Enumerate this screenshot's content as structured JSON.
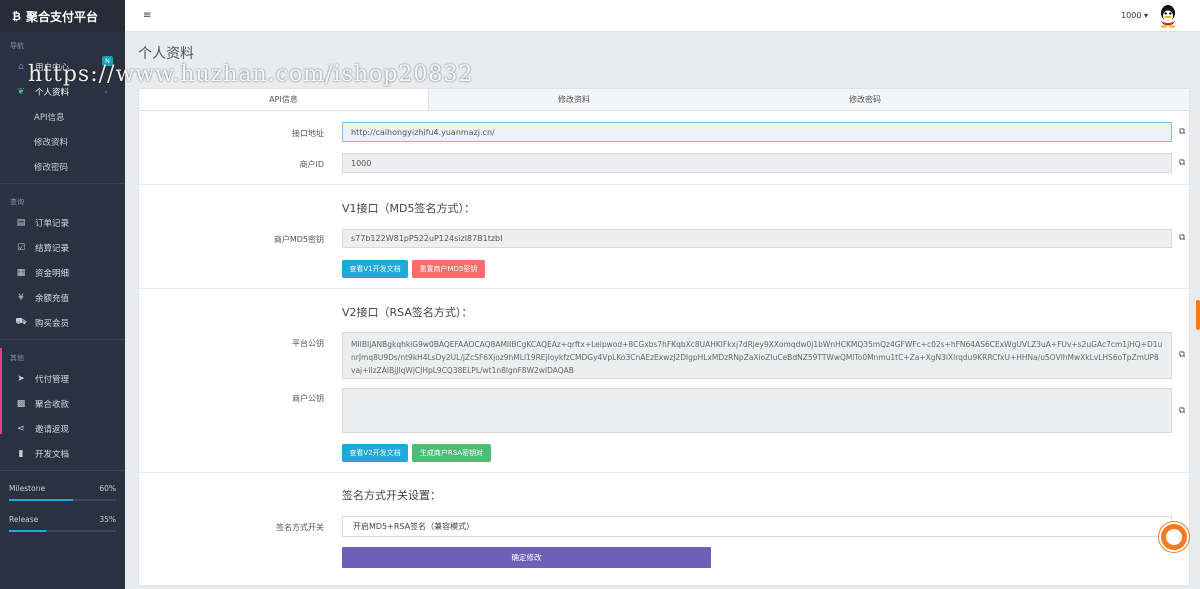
{
  "brand": {
    "logo": "₿",
    "title": "聚合支付平台"
  },
  "sidebar": {
    "section_nav": "导航",
    "user_center": "用户中心",
    "user_center_badge": "N",
    "profile": "个人资料",
    "api_info": "API信息",
    "edit_profile": "修改资料",
    "change_password": "修改密码",
    "section_query": "查询",
    "orders": "订单记录",
    "settlements": "结算记录",
    "funds": "资金明细",
    "recharge": "余额充值",
    "buy_member": "购买会员",
    "section_other": "其他",
    "payout": "代付管理",
    "aggregate_collect": "聚合收款",
    "invite_rebate": "邀请返现",
    "dev_docs": "开发文档",
    "milestone_label": "Milestone",
    "milestone_value": "60%",
    "milestone_fraction": 0.6,
    "release_label": "Release",
    "release_value": "35%",
    "release_fraction": 0.35
  },
  "header": {
    "menu_icon": "≡",
    "user": "1000 ▾"
  },
  "page": {
    "title": "个人资料"
  },
  "tabs": {
    "api": "API信息",
    "edit": "修改资料",
    "password": "修改密码"
  },
  "form": {
    "api_url_label": "接口地址",
    "api_url": "http://caihongyizhifu4.yuanmazj.cn/",
    "merchant_id_label": "商户ID",
    "merchant_id": "1000",
    "v1_title": "V1接口（MD5签名方式）：",
    "md5_key_label": "商户MD5密钥",
    "md5_key": "s77b122W81pP522uP124sizl87B1tzbI",
    "v1_docs_btn": "查看V1开发文档",
    "reset_md5_btn": "重置商户MD5密钥",
    "v2_title": "V2接口（RSA签名方式）：",
    "platform_pubkey_label": "平台公钥",
    "platform_pubkey": "MIIBIjANBgkqhkiG9w0BAQEFAAOCAQ8AMIIBCgKCAQEAz+qrftx+Leipwod+8CGxbs7hFKqbXc8UAHKlFkxj7dRjey9XXomqdw0j1bWnHCKMQ35mQz4GFWFc+c02s+hFN64AS6CExWgUVLZ3uA+FUv+s2uGAc7cm1jHQ+D1unrJmq8U9Ds/nt9kH4LsDy2UL/jZcSF6Xjoz9hMLl19REjIoykfzCMDGy4VpLKo3CnAEzExwzJ2DlgpHLxMDzRNpZaXioZIuCeBdNZ59TTWwQMlTo0Mnmu1tC+Za+XgN3lXlrqdu9KRRCfxU+HHNa/uSOVlhMwXkLvLHS6oTpZmUP8vaj+lIzZAIBjJlqWjCJHpL9CQ38ELPL/wt1n8lgnF8W2wIDAQAB",
    "merchant_pubkey_label": "商户公钥",
    "merchant_pubkey": "",
    "v2_docs_btn": "查看V2开发文档",
    "gen_rsa_btn": "生成商户RSA密钥对",
    "sign_title": "签名方式开关设置：",
    "sign_switch_label": "签名方式开关",
    "sign_switch_value": "开启MD5+RSA签名（兼容模式）",
    "submit_btn": "确定修改"
  },
  "watermark": "https://www.huzhan.com/ishop20832",
  "colors": {
    "sidebar": "#2a3140",
    "accent": "#20a8d8",
    "danger": "#f86c6b",
    "success": "#4dbd74",
    "primary": "#6f5fb8"
  }
}
